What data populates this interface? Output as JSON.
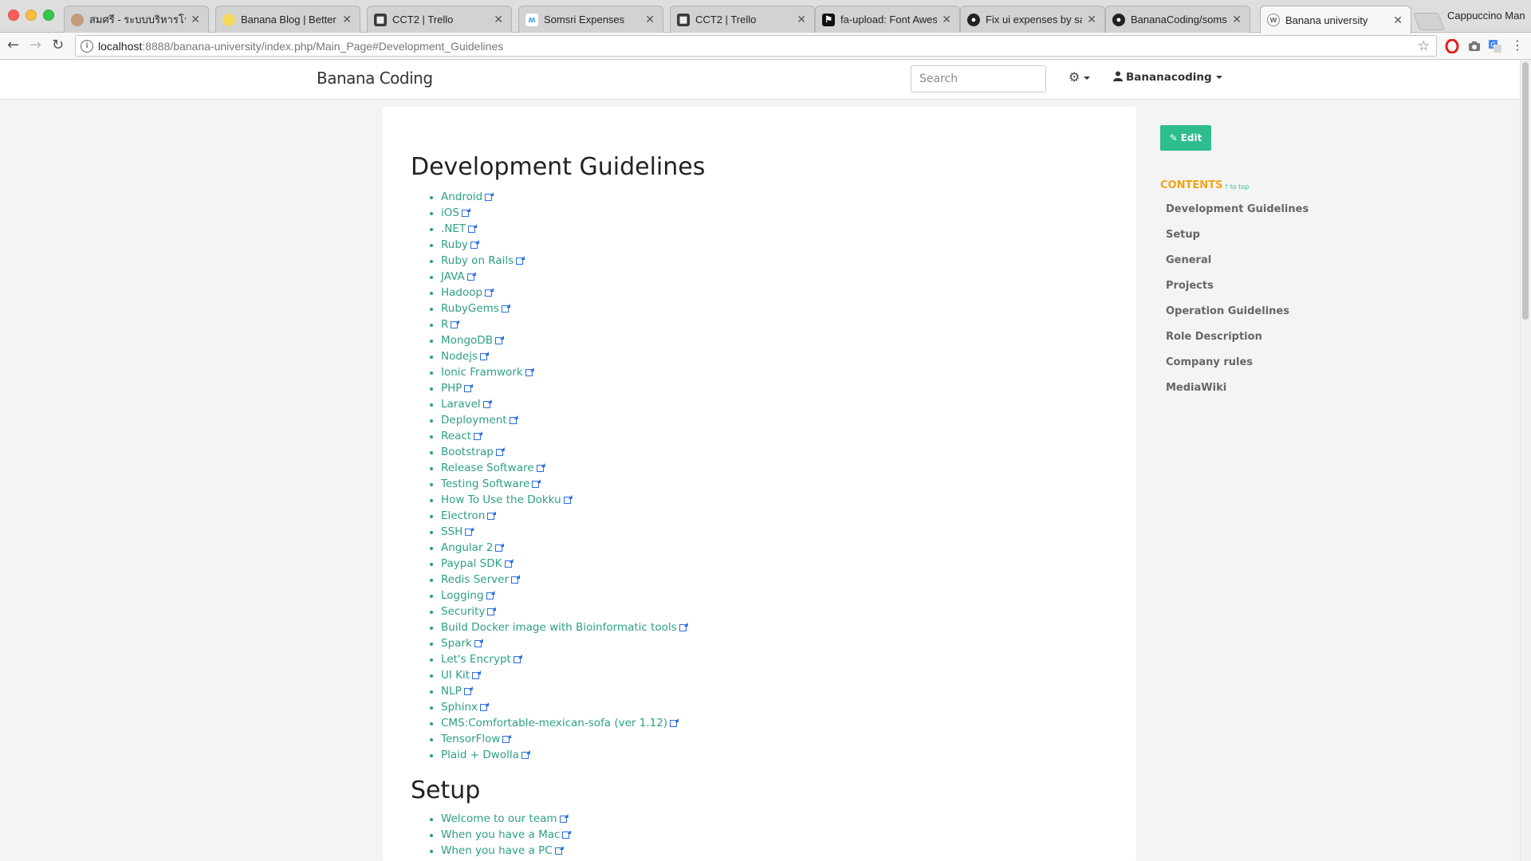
{
  "browser": {
    "tabs": [
      {
        "title": "สมศรี - ระบบบริหารโรงเรียน",
        "favicon": "avatar-icon",
        "active": false
      },
      {
        "title": "Banana Blog | Better by",
        "favicon": "banana-icon",
        "active": false
      },
      {
        "title": "CCT2 | Trello",
        "favicon": "trello-icon",
        "active": false
      },
      {
        "title": "Somsri Expenses",
        "favicon": "somsri-icon",
        "active": false
      },
      {
        "title": "CCT2 | Trello",
        "favicon": "trello-icon",
        "active": false
      },
      {
        "title": "fa-upload: Font Awesome",
        "favicon": "font-awesome-icon",
        "active": false
      },
      {
        "title": "Fix ui expenses by saw",
        "favicon": "github-icon",
        "active": false
      },
      {
        "title": "BananaCoding/somsri |",
        "favicon": "github-icon",
        "active": false
      },
      {
        "title": "Banana university",
        "favicon": "wiki-icon",
        "active": true
      }
    ],
    "profile_name": "Cappuccino Man",
    "url_host": "localhost",
    "url_rest": ":8888/banana-university/index.php/Main_Page#Development_Guidelines"
  },
  "header": {
    "brand": "Banana Coding",
    "search_placeholder": "Search",
    "user": "Bananacoding"
  },
  "sidebar": {
    "edit_label": "Edit",
    "contents_title": "CONTENTS",
    "to_top": "to top",
    "toc": [
      "Development Guidelines",
      "Setup",
      "General",
      "Projects",
      "Operation Guidelines",
      "Role Description",
      "Company rules",
      "MediaWiki"
    ]
  },
  "main": {
    "dev_heading": "Development Guidelines",
    "dev_links": [
      "Android",
      "iOS",
      ".NET",
      "Ruby",
      "Ruby on Rails",
      "JAVA",
      "Hadoop",
      "RubyGems",
      "R",
      "MongoDB",
      "Nodejs",
      "Ionic Framwork",
      "PHP",
      "Laravel",
      "Deployment",
      "React",
      "Bootstrap",
      "Release Software",
      "Testing Software",
      "How To Use the Dokku",
      "Electron",
      "SSH",
      "Angular 2",
      "Paypal SDK",
      "Redis Server",
      "Logging",
      "Security",
      "Build Docker image with Bioinformatic tools",
      "Spark",
      "Let's Encrypt",
      "UI Kit",
      "NLP",
      "Sphinx",
      "CMS:Comfortable-mexican-sofa (ver 1.12)",
      "TensorFlow",
      "Plaid + Dwolla"
    ],
    "setup_heading": "Setup",
    "setup_links": [
      "Welcome to our team",
      "When you have a Mac",
      "When you have a PC"
    ]
  },
  "colors": {
    "link": "#2c9f86",
    "edit_button": "#2dbd8f",
    "contents_title": "#f0a51c"
  }
}
